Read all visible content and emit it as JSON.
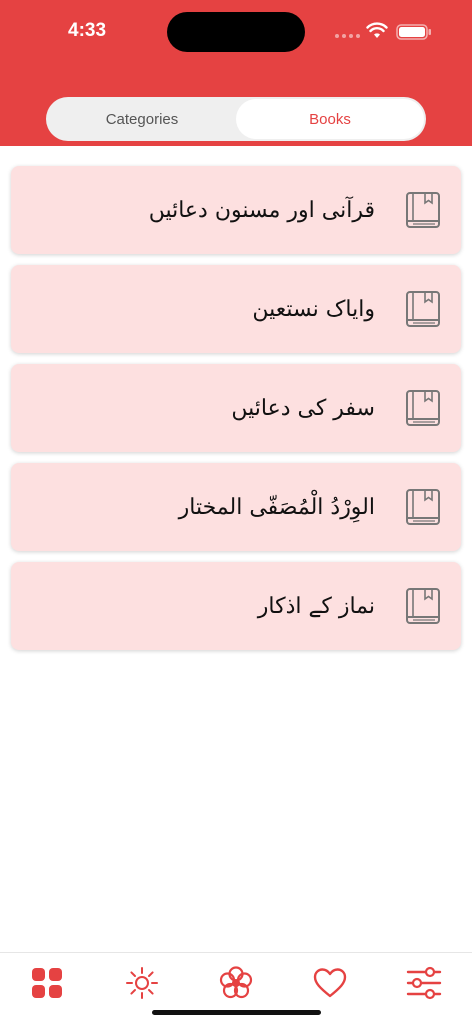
{
  "status_bar": {
    "time": "4:33"
  },
  "segmented": {
    "tabs": [
      {
        "label": "Categories",
        "active": false
      },
      {
        "label": "Books",
        "active": true
      }
    ]
  },
  "books": [
    {
      "title": "قرآنی اور مسنون دعائیں",
      "icon": "book-icon"
    },
    {
      "title": "وایاک نستعین",
      "icon": "book-icon"
    },
    {
      "title": "سفر کی دعائیں",
      "icon": "book-icon"
    },
    {
      "title": "الوِرْدُ الْمُصَفّی المختار",
      "icon": "book-icon"
    },
    {
      "title": "نماز کے اذکار",
      "icon": "book-icon"
    }
  ],
  "tab_bar": {
    "items": [
      {
        "icon": "grid-icon"
      },
      {
        "icon": "sun-icon"
      },
      {
        "icon": "flower-icon"
      },
      {
        "icon": "heart-icon"
      },
      {
        "icon": "sliders-icon"
      }
    ]
  },
  "colors": {
    "accent": "#e54242",
    "card_background": "#fde0e0",
    "icon_gray": "#777777"
  }
}
